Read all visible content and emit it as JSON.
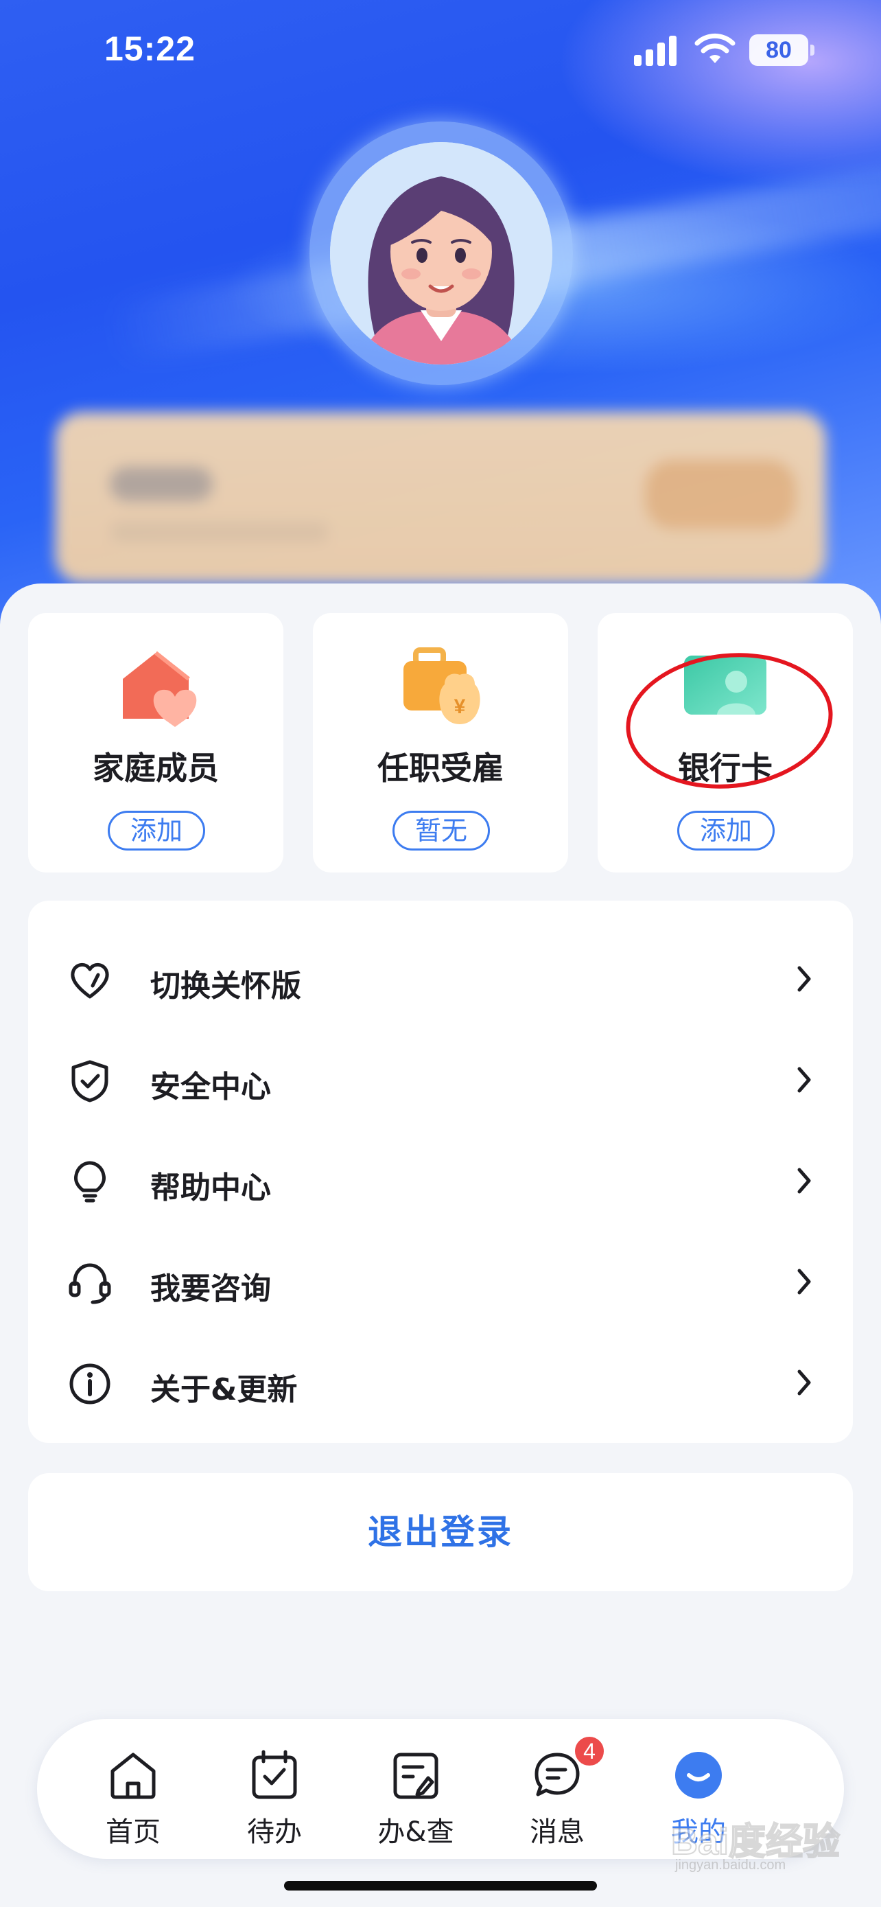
{
  "status_bar": {
    "time": "15:22",
    "battery": "80",
    "icons": [
      "signal-icon",
      "wifi-icon",
      "battery-icon"
    ]
  },
  "profile": {
    "avatar": "avatar-woman"
  },
  "shortcuts": [
    {
      "title": "家庭成员",
      "action": "添加",
      "icon": "family-house-heart-icon"
    },
    {
      "title": "任职受雇",
      "action": "暂无",
      "icon": "briefcase-yen-icon"
    },
    {
      "title": "银行卡",
      "action": "添加",
      "icon": "bank-card-icon"
    }
  ],
  "menu": [
    {
      "label": "切换关怀版",
      "icon": "heart-icon"
    },
    {
      "label": "安全中心",
      "icon": "shield-check-icon"
    },
    {
      "label": "帮助中心",
      "icon": "lightbulb-icon"
    },
    {
      "label": "我要咨询",
      "icon": "headset-icon"
    },
    {
      "label": "关于&更新",
      "icon": "info-icon"
    }
  ],
  "logout_label": "退出登录",
  "tabs": [
    {
      "label": "首页",
      "icon": "home-icon",
      "active": false
    },
    {
      "label": "待办",
      "icon": "calendar-check-icon",
      "active": false
    },
    {
      "label": "办&查",
      "icon": "form-edit-icon",
      "active": false
    },
    {
      "label": "消息",
      "icon": "chat-bubble-icon",
      "active": false,
      "badge": "4"
    },
    {
      "label": "我的",
      "icon": "smile-profile-icon",
      "active": true
    }
  ],
  "watermark": {
    "text": "Bai度经验",
    "sub": "jingyan.baidu.com"
  },
  "colors": {
    "accent": "#3d7cf0",
    "badge": "#ec4b4b",
    "annotation": "#e4161f",
    "hero": "#2454f0"
  }
}
